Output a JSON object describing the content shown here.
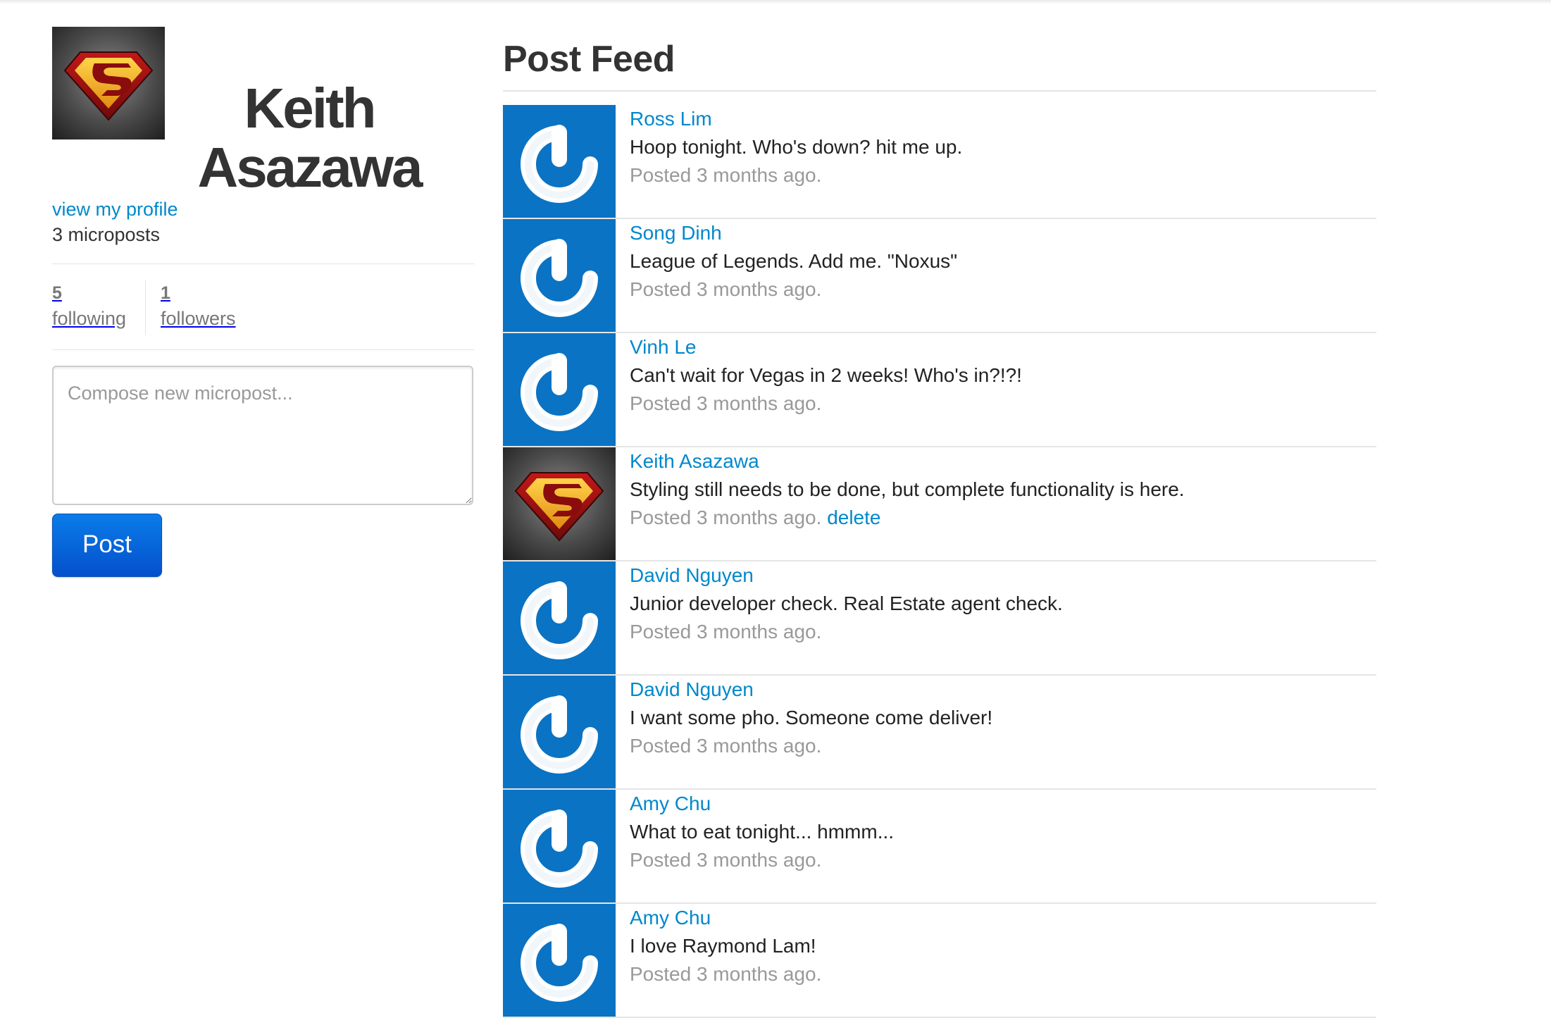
{
  "user": {
    "name": "Keith Asazawa",
    "avatar_icon": "superman-logo-icon",
    "profile_link": "view my profile",
    "micropost_count": "3 microposts",
    "following_count": "5",
    "following_label": "following",
    "followers_count": "1",
    "followers_label": "followers"
  },
  "compose": {
    "placeholder": "Compose new micropost...",
    "post_label": "Post"
  },
  "feed": {
    "title": "Post Feed",
    "items": [
      {
        "author": "Ross Lim",
        "content": "Hoop tonight. Who's down? hit me up.",
        "timestamp": "Posted 3 months ago.",
        "avatar_icon": "gravatar-icon",
        "delete": ""
      },
      {
        "author": "Song Dinh",
        "content": "League of Legends. Add me. \"Noxus\"",
        "timestamp": "Posted 3 months ago.",
        "avatar_icon": "gravatar-icon",
        "delete": ""
      },
      {
        "author": "Vinh Le",
        "content": "Can't wait for Vegas in 2 weeks! Who's in?!?!",
        "timestamp": "Posted 3 months ago.",
        "avatar_icon": "gravatar-icon",
        "delete": ""
      },
      {
        "author": "Keith Asazawa",
        "content": "Styling still needs to be done, but complete functionality is here.",
        "timestamp": "Posted 3 months ago.",
        "avatar_icon": "superman-logo-icon",
        "delete": "delete"
      },
      {
        "author": "David Nguyen",
        "content": "Junior developer check. Real Estate agent check.",
        "timestamp": "Posted 3 months ago.",
        "avatar_icon": "gravatar-icon",
        "delete": ""
      },
      {
        "author": "David Nguyen",
        "content": "I want some pho. Someone come deliver!",
        "timestamp": "Posted 3 months ago.",
        "avatar_icon": "gravatar-icon",
        "delete": ""
      },
      {
        "author": "Amy Chu",
        "content": "What to eat tonight... hmmm...",
        "timestamp": "Posted 3 months ago.",
        "avatar_icon": "gravatar-icon",
        "delete": ""
      },
      {
        "author": "Amy Chu",
        "content": "I love Raymond Lam!",
        "timestamp": "Posted 3 months ago.",
        "avatar_icon": "gravatar-icon",
        "delete": ""
      }
    ]
  },
  "colors": {
    "link": "#0088cc",
    "gravatar_bg": "#0a73c4",
    "button": "#0450cc",
    "muted": "#999999"
  }
}
